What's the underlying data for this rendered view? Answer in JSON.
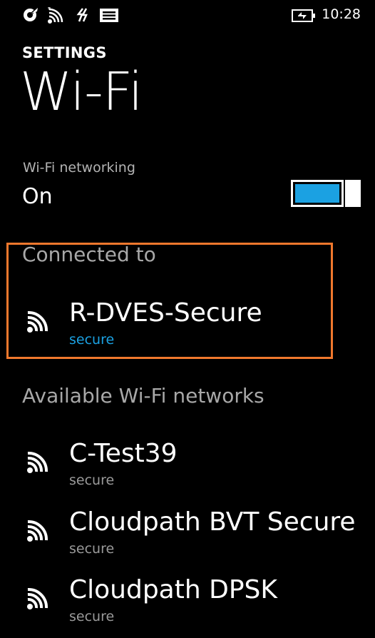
{
  "status_bar": {
    "time": "10:28",
    "icons": [
      "location-icon",
      "signal-strength-icon",
      "data-connection-icon",
      "notification-icon",
      "battery-charging-icon"
    ]
  },
  "header": {
    "app_title": "SETTINGS",
    "page_title": "Wi-Fi"
  },
  "wifi_toggle": {
    "label": "Wi-Fi networking",
    "state": "On",
    "enabled": true,
    "accent_color": "#1ba1e2"
  },
  "connected": {
    "header": "Connected to",
    "network": {
      "name": "R-DVES-Secure",
      "status": "secure"
    },
    "highlight_color": "#f0782d"
  },
  "available": {
    "header": "Available Wi-Fi networks",
    "networks": [
      {
        "name": "C-Test39",
        "status": "secure"
      },
      {
        "name": "Cloudpath BVT Secure",
        "status": "secure"
      },
      {
        "name": "Cloudpath DPSK",
        "status": "secure"
      }
    ]
  }
}
